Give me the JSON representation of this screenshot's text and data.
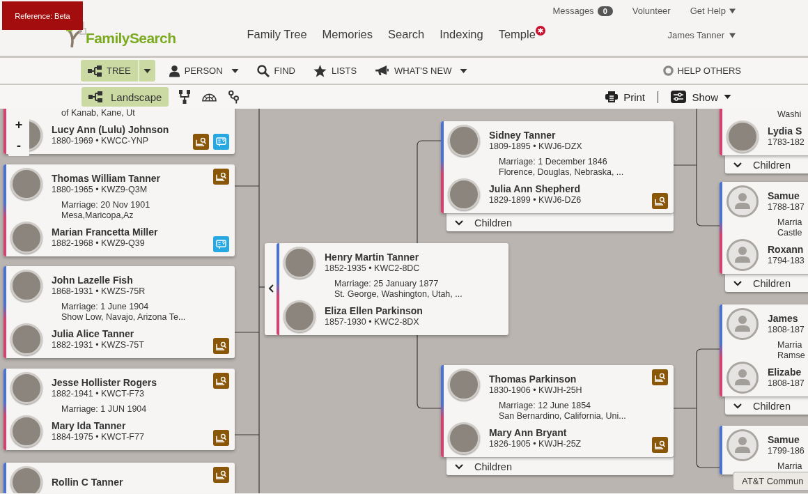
{
  "reference_badge": "Reference: Beta",
  "logo": {
    "text": "FamilySearch"
  },
  "utility_links": [
    {
      "kind": "messages",
      "label": "Messages",
      "count": "0"
    },
    {
      "kind": "link",
      "label": "Volunteer"
    },
    {
      "kind": "menu",
      "label": "Get Help"
    }
  ],
  "nav": [
    {
      "label": "Family Tree",
      "alert": false
    },
    {
      "label": "Memories",
      "alert": false
    },
    {
      "label": "Search",
      "alert": false
    },
    {
      "label": "Indexing",
      "alert": false
    },
    {
      "label": "Temple",
      "alert": true
    }
  ],
  "user_menu": {
    "label": "James Tanner"
  },
  "toolbar": [
    {
      "kind": "tree",
      "label": "TREE",
      "selected": true,
      "dropdown": true
    },
    {
      "kind": "person",
      "label": "PERSON",
      "selected": false,
      "dropdown": true
    },
    {
      "kind": "find",
      "label": "FIND",
      "selected": false,
      "dropdown": false
    },
    {
      "kind": "lists",
      "label": "LISTS",
      "selected": false,
      "dropdown": false
    },
    {
      "kind": "news",
      "label": "WHAT'S NEW",
      "selected": false,
      "dropdown": true
    }
  ],
  "help_others": "HELP OTHERS",
  "view_options": [
    {
      "kind": "landscape",
      "label": "Landscape",
      "selected": true
    },
    {
      "kind": "portrait",
      "selected": false
    },
    {
      "kind": "fan",
      "selected": false
    },
    {
      "kind": "descendancy",
      "selected": false
    }
  ],
  "print": "Print",
  "show": "Show",
  "zoom_controls": [
    "+",
    "-"
  ],
  "couples": [
    {
      "marriage": {
        "place": "of Kanab, Kane, Ut"
      },
      "wife": {
        "name": "Lucy Ann (Lulu) Johnson",
        "dates": "1880-1969 • KWCC-YNP",
        "photo": true,
        "hints": [
          {
            "kind": "record"
          },
          {
            "kind": "problem"
          }
        ]
      }
    },
    {
      "husband": {
        "name": "Thomas William Tanner",
        "dates": "1880-1965 • KWZ9-Q3M",
        "photo": true,
        "hints": [
          {
            "kind": "record"
          }
        ]
      },
      "marriage": {
        "date": "Marriage: 20 Nov 1901",
        "place": "Mesa,Maricopa,Az"
      },
      "wife": {
        "name": "Marian Francetta Miller",
        "dates": "1882-1968 • KWZ9-Q39",
        "photo": true,
        "hints": [
          {
            "kind": "problem"
          }
        ]
      }
    },
    {
      "husband": {
        "name": "John Lazelle Fish",
        "dates": "1868-1931 • KWZS-75R",
        "photo": true
      },
      "marriage": {
        "date": "Marriage: 1 June 1904",
        "place": "Show Low, Navajo, Arizona Te..."
      },
      "wife": {
        "name": "Julia Alice Tanner",
        "dates": "1882-1931 • KWZS-75T",
        "photo": true,
        "hints": [
          {
            "kind": "record"
          }
        ]
      }
    },
    {
      "husband": {
        "name": "Jesse Hollister Rogers",
        "dates": "1882-1941 • KWCT-F73",
        "photo": true,
        "hints": [
          {
            "kind": "record"
          }
        ]
      },
      "marriage": {
        "date": "Marriage: 1 JUN 1904"
      },
      "wife": {
        "name": "Mary Ida Tanner",
        "dates": "1884-1975 • KWCT-F77",
        "photo": true,
        "hints": [
          {
            "kind": "record"
          }
        ]
      }
    },
    {
      "husband": {
        "name": "Rollin C Tanner",
        "photo": true,
        "hints": [
          {
            "kind": "record"
          }
        ]
      }
    },
    {
      "parents_toggle": true,
      "husband": {
        "name": "Henry Martin Tanner",
        "dates": "1852-1935 • KWC2-8DC",
        "photo": true
      },
      "marriage": {
        "date": "Marriage: 25 January 1877",
        "place": "St. George, Washington, Utah, ..."
      },
      "wife": {
        "name": "Eliza Ellen Parkinson",
        "dates": "1857-1930 • KWC2-8DX",
        "photo": true
      }
    },
    {
      "husband": {
        "name": "Sidney Tanner",
        "dates": "1809-1895 • KWJ6-DZX",
        "photo": true
      },
      "marriage": {
        "date": "Marriage: 1 December 1846",
        "place": "Florence, Douglas, Nebraska, ..."
      },
      "wife": {
        "name": "Julia Ann Shepherd",
        "dates": "1829-1899 • KWJ6-DZ6",
        "photo": true,
        "hints": [
          {
            "kind": "record"
          }
        ]
      },
      "children": "Children"
    },
    {
      "husband": {
        "name": "Thomas Parkinson",
        "dates": "1830-1906 • KWJH-25H",
        "photo": true,
        "hints": [
          {
            "kind": "record"
          }
        ]
      },
      "marriage": {
        "date": "Marriage: 12 June 1854",
        "place": "San Bernardino, California, Uni..."
      },
      "wife": {
        "name": "Mary Ann Bryant",
        "dates": "1826-1905 • KWJH-25Z",
        "photo": true,
        "hints": [
          {
            "kind": "record"
          }
        ]
      },
      "children": "Children"
    },
    {
      "marriage": {
        "place": "Washi"
      },
      "wife": {
        "name": "Lydia S",
        "dates": "1783-182",
        "photo": true
      },
      "children": "Children"
    },
    {
      "husband": {
        "name": "Samue",
        "dates": "1788-187",
        "photo": false
      },
      "marriage": {
        "date": "Marria",
        "place": "Castle"
      },
      "wife": {
        "name": "Roxann",
        "dates": "1794-183",
        "photo": false
      },
      "children": "Children"
    },
    {
      "husband": {
        "name": "James",
        "dates": "1808-187",
        "photo": false
      },
      "marriage": {
        "date": "Marria",
        "place": "Ramse"
      },
      "wife": {
        "name": "Elizabe",
        "dates": "1808-187",
        "photo": false
      },
      "children": "Children"
    },
    {
      "husband": {
        "name": "Samue",
        "dates": "1799-186",
        "photo": false
      },
      "marriage": {
        "date": "Marria"
      }
    }
  ],
  "status_tooltip": "AT&T Commun"
}
